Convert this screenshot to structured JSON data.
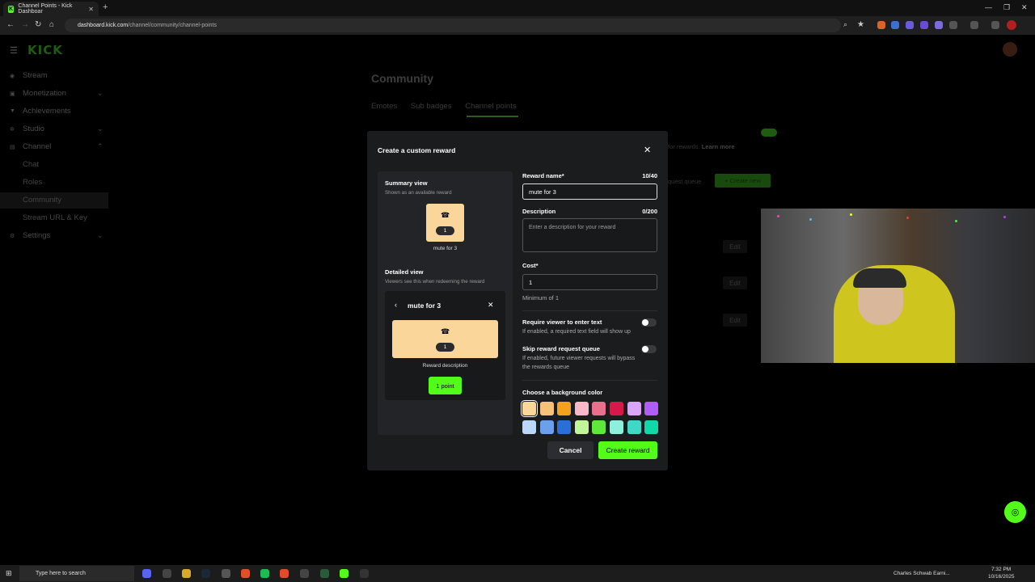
{
  "browser": {
    "tab_title": "Channel Points - Kick Dashboar",
    "url_host": "dashboard.kick.com",
    "url_path": "/channel/community/channel-points"
  },
  "app": {
    "logo": "KICK"
  },
  "sidebar": {
    "items": [
      {
        "label": "Stream"
      },
      {
        "label": "Monetization"
      },
      {
        "label": "Achievements"
      },
      {
        "label": "Studio"
      },
      {
        "label": "Channel"
      },
      {
        "label": "Settings"
      }
    ],
    "channel_sub": [
      {
        "label": "Chat"
      },
      {
        "label": "Roles"
      },
      {
        "label": "Community"
      },
      {
        "label": "Stream URL & Key"
      }
    ]
  },
  "page": {
    "title": "Community",
    "tabs": [
      {
        "label": "Emotes"
      },
      {
        "label": "Sub badges"
      },
      {
        "label": "Channel points"
      }
    ],
    "bg_text_prefix": "for rewards.",
    "bg_learn_more": "Learn more",
    "bg_queue": "quest queue",
    "bg_create": "+ Create new",
    "bg_edit": "Edit"
  },
  "modal": {
    "title": "Create a custom reward",
    "summary_heading": "Summary view",
    "summary_sub": "Shown as an available reward",
    "card_cost": "1",
    "card_name": "mute for 3",
    "detailed_heading": "Detailed view",
    "detailed_sub": "Viewers see this when redeeming the reward",
    "detail_title": "mute for 3",
    "detail_desc": "Reward description",
    "point_button": "1 point",
    "reward_name_label": "Reward name*",
    "reward_name_count": "10/40",
    "reward_name_value": "mute for 3",
    "description_label": "Description",
    "description_count": "0/200",
    "description_placeholder": "Enter a description for your reward",
    "cost_label": "Cost*",
    "cost_value": "1",
    "cost_hint": "Minimum of 1",
    "require_text_label": "Require viewer to enter text",
    "require_text_hint": "If enabled, a required text field will show up",
    "require_text_enabled": false,
    "skip_queue_label": "Skip reward request queue",
    "skip_queue_hint_1": "If enabled, future viewer requests will bypass",
    "skip_queue_hint_2": "the rewards queue",
    "skip_queue_enabled": false,
    "color_label": "Choose a background color",
    "colors": [
      "#fbd69a",
      "#f6c27a",
      "#f3a21b",
      "#f7b8c8",
      "#e8708c",
      "#d8174a",
      "#d8a6f5",
      "#b05cf6",
      "#bcd8f8",
      "#6aa0ec",
      "#2a6fd8",
      "#c2f59a",
      "#5ee83a",
      "#8ef0dc",
      "#3fd8c6",
      "#10d8a8"
    ],
    "selected_color": "#fbd69a",
    "cancel": "Cancel",
    "create": "Create reward"
  },
  "taskbar": {
    "search_placeholder": "Type here to search",
    "news": "Charles Schwab Earni...",
    "time": "7:32 PM",
    "date": "10/16/2025"
  }
}
